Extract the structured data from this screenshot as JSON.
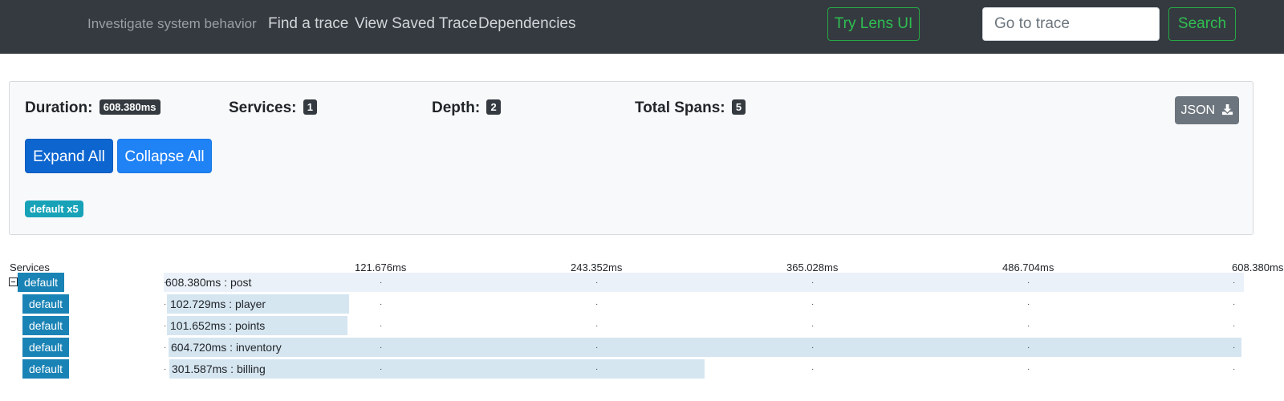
{
  "navbar": {
    "brand": "Investigate system behavior",
    "links": [
      "Find a trace",
      "View Saved Trace",
      "Dependencies"
    ],
    "lens_button": "Try Lens UI",
    "trace_input_placeholder": "Go to trace",
    "search_button": "Search"
  },
  "summary": {
    "duration_label": "Duration:",
    "duration_value": "608.380ms",
    "services_label": "Services:",
    "services_value": "1",
    "depth_label": "Depth:",
    "depth_value": "2",
    "total_spans_label": "Total Spans:",
    "total_spans_value": "5",
    "json_button": "JSON",
    "json_icon": "download-icon",
    "expand_all": "Expand All",
    "collapse_all": "Collapse All",
    "service_badge": "default x5"
  },
  "timeline": {
    "services_header": "Services",
    "total_ms": 608.38,
    "ticks": [
      "121.676ms",
      "243.352ms",
      "365.028ms",
      "486.704ms",
      "608.380ms"
    ],
    "spans": [
      {
        "service": "default",
        "label": "608.380ms : post",
        "offset_ms": 0,
        "duration_ms": 608.38,
        "depth": 0,
        "expanded": true
      },
      {
        "service": "default",
        "label": "102.729ms : player",
        "offset_ms": 1.8,
        "duration_ms": 102.729,
        "depth": 1
      },
      {
        "service": "default",
        "label": "101.652ms : points",
        "offset_ms": 1.8,
        "duration_ms": 101.652,
        "depth": 1
      },
      {
        "service": "default",
        "label": "604.720ms : inventory",
        "offset_ms": 2.5,
        "duration_ms": 604.72,
        "depth": 1
      },
      {
        "service": "default",
        "label": "301.587ms : billing",
        "offset_ms": 3.0,
        "duration_ms": 301.587,
        "depth": 1
      }
    ]
  },
  "colors": {
    "navbar_bg": "#343a40",
    "success": "#28a745",
    "primary_active": "#0d66d0",
    "primary": "#1f82f5",
    "info_badge": "#17a2b8",
    "service_tag": "#1a83b5",
    "span_bar": "#d6e6f1",
    "root_row": "#eaf1f8"
  }
}
